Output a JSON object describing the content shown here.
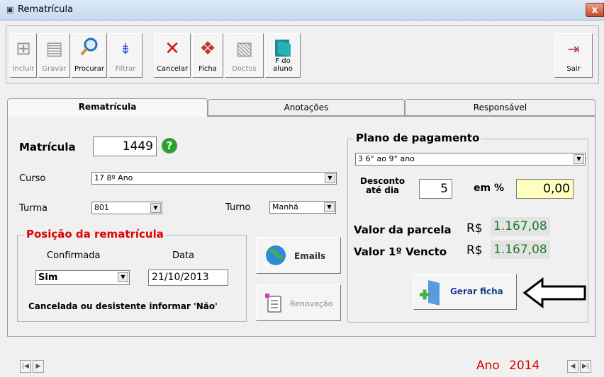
{
  "window": {
    "title": "Rematrícula",
    "close_label": "x"
  },
  "toolbar": {
    "incluir": "Incluir",
    "gravar": "Gravar",
    "procurar": "Procurar",
    "filtrar": "Filtrar",
    "cancelar": "Cancelar",
    "ficha": "Ficha",
    "doctos": "Doctos",
    "f_aluno": "F do aluno",
    "sair": "Sair"
  },
  "tabs": {
    "rematricula": "Rematrícula",
    "anotacoes": "Anotações",
    "responsavel": "Responsável"
  },
  "form": {
    "matricula_label": "Matrícula",
    "matricula_value": "1449",
    "curso_label": "Curso",
    "curso_value": "17  8º Ano",
    "turma_label": "Turma",
    "turma_value": "801",
    "turno_label": "Turno",
    "turno_value": "Manhã"
  },
  "posicao": {
    "title": "Posição da rematrícula",
    "confirmada_label": "Confirmada",
    "confirmada_value": "Sim",
    "data_label": "Data",
    "data_value": "21/10/2013",
    "note": "Cancelada ou desistente informar 'Não'"
  },
  "actions": {
    "emails": "Emails",
    "renovacao": "Renovação",
    "gerar_ficha": "Gerar ficha"
  },
  "plano": {
    "title": "Plano de pagamento",
    "value": "3  6° ao 9° ano",
    "desconto_label_1": "Desconto",
    "desconto_label_2": "até dia",
    "desconto_value": "5",
    "em_pct_label": "em %",
    "em_pct_value": "0,00",
    "parcela_label": "Valor da parcela",
    "parcela_currency": "R$",
    "parcela_value": "1.167,08",
    "vencto_label": "Valor 1º Vencto",
    "vencto_currency": "R$",
    "vencto_value": "1.167,08"
  },
  "footer": {
    "ano_label": "Ano",
    "ano_value": "2014"
  },
  "colors": {
    "accent_red": "#e00000",
    "value_green": "#1f7a2a",
    "highlight_yellow": "#ffffc0"
  }
}
